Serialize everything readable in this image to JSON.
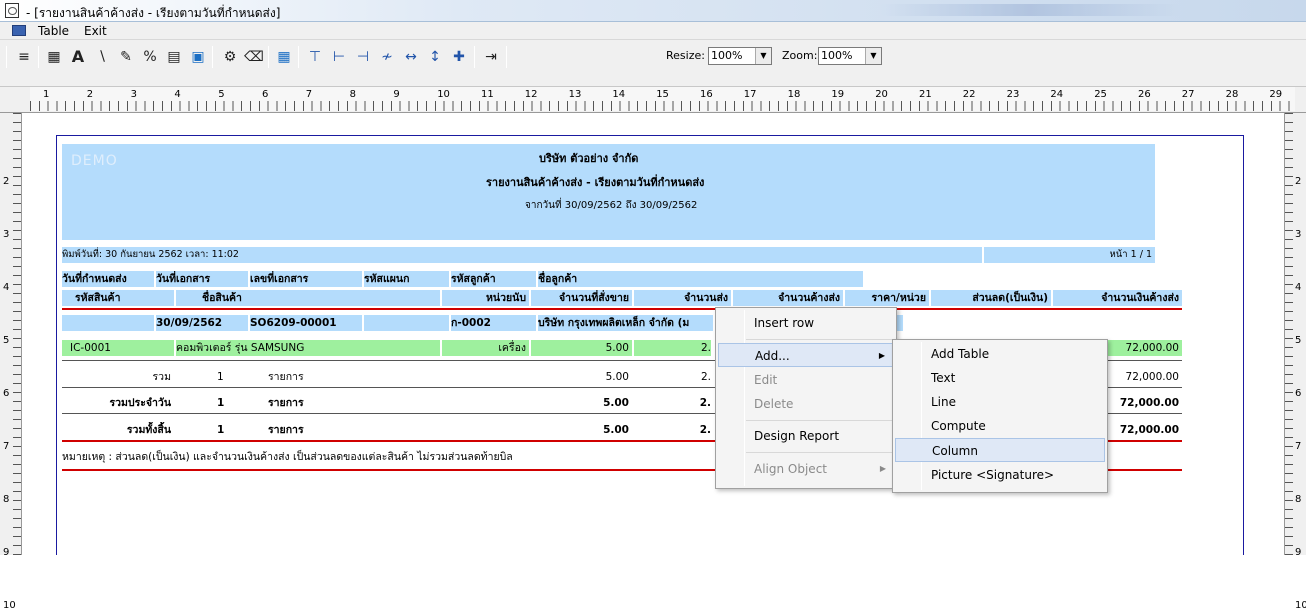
{
  "window": {
    "title": " - [รายงานสินค้าค้างส่ง - เรียงตามวันที่กำหนดส่ง]"
  },
  "menubar": {
    "items": [
      "Table",
      "Exit"
    ]
  },
  "toolbar": {
    "resize_label": "Resize:",
    "resize_value": "100%",
    "zoom_label": "Zoom:",
    "zoom_value": "100%"
  },
  "ruler": {
    "top": [
      "1",
      "2",
      "3",
      "4",
      "5",
      "6",
      "7",
      "8",
      "9",
      "10",
      "11",
      "12",
      "13",
      "14",
      "15",
      "16",
      "17",
      "18",
      "19",
      "20",
      "21",
      "22",
      "23",
      "24",
      "25",
      "26",
      "27",
      "28",
      "29"
    ],
    "side": [
      "2",
      "3",
      "4",
      "5",
      "6",
      "7",
      "8",
      "9",
      "10"
    ]
  },
  "report": {
    "watermark": "DEMO",
    "company": "บริษัท ตัวอย่าง จำกัด",
    "title": "รายงานสินค้าค้างส่ง - เรียงตามวันที่กำหนดส่ง",
    "date_range": "จากวันที่ 30/09/2562 ถึง 30/09/2562",
    "print_date": "พิมพ์วันที่: 30 กันยายน 2562 เวลา: 11:02",
    "page": "หน้า 1 / 1",
    "header1": [
      "วันที่กำหนดส่ง",
      "วันที่เอกสาร",
      "เลขที่เอกสาร",
      "รหัสแผนก",
      "รหัสลูกค้า",
      "ชื่อลูกค้า"
    ],
    "header2": [
      "รหัสสินค้า",
      "ชื่อสินค้า",
      "หน่วยนับ",
      "จำนวนที่สั่งขาย",
      "จำนวนส่ง",
      "จำนวนค้างส่ง",
      "ราคา/หน่วย",
      "ส่วนลด(เป็นเงิน)",
      "จำนวนเงินค้างส่ง"
    ],
    "doc_row": {
      "doc_date": "30/09/2562",
      "doc_no": "SO6209-00001",
      "customer_code": "ก-0002",
      "customer_name": "บริษัท กรุงเทพผลิตเหล็ก จำกัด (ม"
    },
    "item_row": {
      "code": "IC-0001",
      "name": "คอมพิวเตอร์ รุ่น SAMSUNG",
      "unit": "เครื่อง",
      "qty": "5.00",
      "sent": "2.",
      "amount": "72,000.00"
    },
    "totals": [
      {
        "label": "รวม",
        "count": "1",
        "unit": "รายการ",
        "qty": "5.00",
        "sent": "2.",
        "amount": "72,000.00"
      },
      {
        "label": "รวมประจำวัน",
        "count": "1",
        "unit": "รายการ",
        "qty": "5.00",
        "sent": "2.",
        "amount": "72,000.00"
      },
      {
        "label": "รวมทั้งสิ้น",
        "count": "1",
        "unit": "รายการ",
        "qty": "5.00",
        "sent": "2.",
        "amount": "72,000.00"
      }
    ],
    "note": "หมายเหตุ : ส่วนลด(เป็นเงิน) และจำนวนเงินค้างส่ง เป็นส่วนลดของแต่ละสินค้า ไม่รวมส่วนลดท้ายบิล"
  },
  "context_menu": {
    "items": [
      "Insert row",
      "Add...",
      "Edit",
      "Delete",
      "Design Report",
      "Align Object"
    ]
  },
  "submenu": {
    "items": [
      "Add Table",
      "Text",
      "Line",
      "Compute",
      "Column",
      "Picture <Signature>"
    ]
  }
}
